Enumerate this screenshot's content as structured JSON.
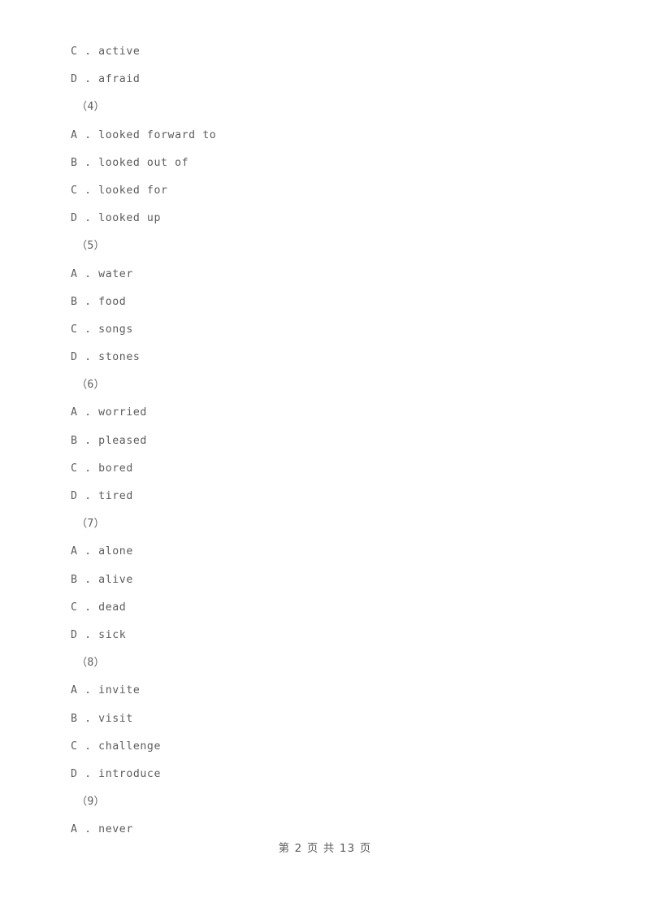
{
  "document": {
    "page_label": "第 2 页 共 13 页",
    "page_current": "2",
    "page_total": "13",
    "text_color": "#5c5c5c",
    "background_color": "#ffffff"
  },
  "lines": [
    {
      "id": "l0",
      "kind": "option",
      "text": "C . active"
    },
    {
      "id": "l1",
      "kind": "option",
      "text": "D . afraid"
    },
    {
      "id": "l2",
      "kind": "question",
      "text": "（4）"
    },
    {
      "id": "l3",
      "kind": "option",
      "text": "A . looked forward to"
    },
    {
      "id": "l4",
      "kind": "option",
      "text": "B . looked out of"
    },
    {
      "id": "l5",
      "kind": "option",
      "text": "C . looked for"
    },
    {
      "id": "l6",
      "kind": "option",
      "text": "D . looked up"
    },
    {
      "id": "l7",
      "kind": "question",
      "text": "（5）"
    },
    {
      "id": "l8",
      "kind": "option",
      "text": "A . water"
    },
    {
      "id": "l9",
      "kind": "option",
      "text": "B . food"
    },
    {
      "id": "l10",
      "kind": "option",
      "text": "C . songs"
    },
    {
      "id": "l11",
      "kind": "option",
      "text": "D . stones"
    },
    {
      "id": "l12",
      "kind": "question",
      "text": "（6）"
    },
    {
      "id": "l13",
      "kind": "option",
      "text": "A . worried"
    },
    {
      "id": "l14",
      "kind": "option",
      "text": "B . pleased"
    },
    {
      "id": "l15",
      "kind": "option",
      "text": "C . bored"
    },
    {
      "id": "l16",
      "kind": "option",
      "text": "D . tired"
    },
    {
      "id": "l17",
      "kind": "question",
      "text": "（7）"
    },
    {
      "id": "l18",
      "kind": "option",
      "text": "A . alone"
    },
    {
      "id": "l19",
      "kind": "option",
      "text": "B . alive"
    },
    {
      "id": "l20",
      "kind": "option",
      "text": "C . dead"
    },
    {
      "id": "l21",
      "kind": "option",
      "text": "D . sick"
    },
    {
      "id": "l22",
      "kind": "question",
      "text": "（8）"
    },
    {
      "id": "l23",
      "kind": "option",
      "text": "A . invite"
    },
    {
      "id": "l24",
      "kind": "option",
      "text": "B . visit"
    },
    {
      "id": "l25",
      "kind": "option",
      "text": "C . challenge"
    },
    {
      "id": "l26",
      "kind": "option",
      "text": "D . introduce"
    },
    {
      "id": "l27",
      "kind": "question",
      "text": "（9）"
    },
    {
      "id": "l28",
      "kind": "option",
      "text": "A . never"
    }
  ]
}
